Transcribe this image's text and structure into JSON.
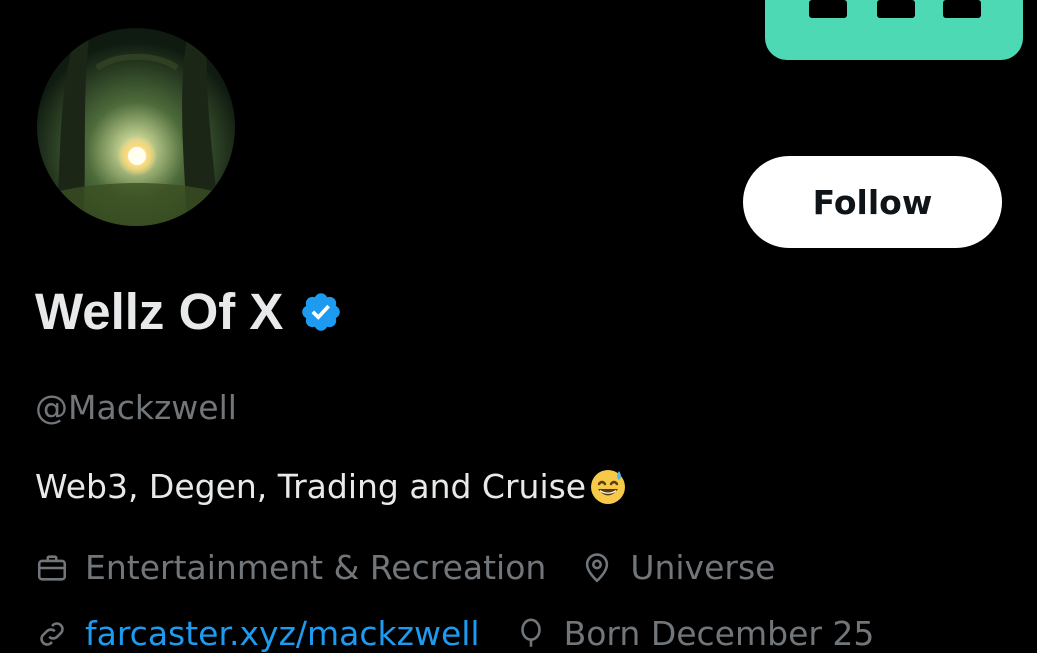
{
  "profile": {
    "display_name": "Wellz Of X",
    "handle": "@Mackzwell",
    "bio": "Web3, Degen, Trading and Cruise",
    "bio_emoji": "grinning-face-with-sweat-emoji",
    "verified": true,
    "follow_label": "Follow"
  },
  "meta": {
    "category": "Entertainment & Recreation",
    "location": "Universe",
    "website": "farcaster.xyz/mackzwell",
    "birthday": "Born December 25"
  },
  "icons": {
    "category": "briefcase-icon",
    "location": "location-pin-icon",
    "website": "link-icon",
    "birthday": "balloon-icon",
    "verified": "verified-badge-icon"
  },
  "colors": {
    "background": "#000000",
    "text_primary": "#e7e9ea",
    "text_secondary": "#71767b",
    "link": "#1d9bf0",
    "verified": "#1d9bf0",
    "banner_accent": "#4dd9b3",
    "follow_bg": "#ffffff"
  }
}
